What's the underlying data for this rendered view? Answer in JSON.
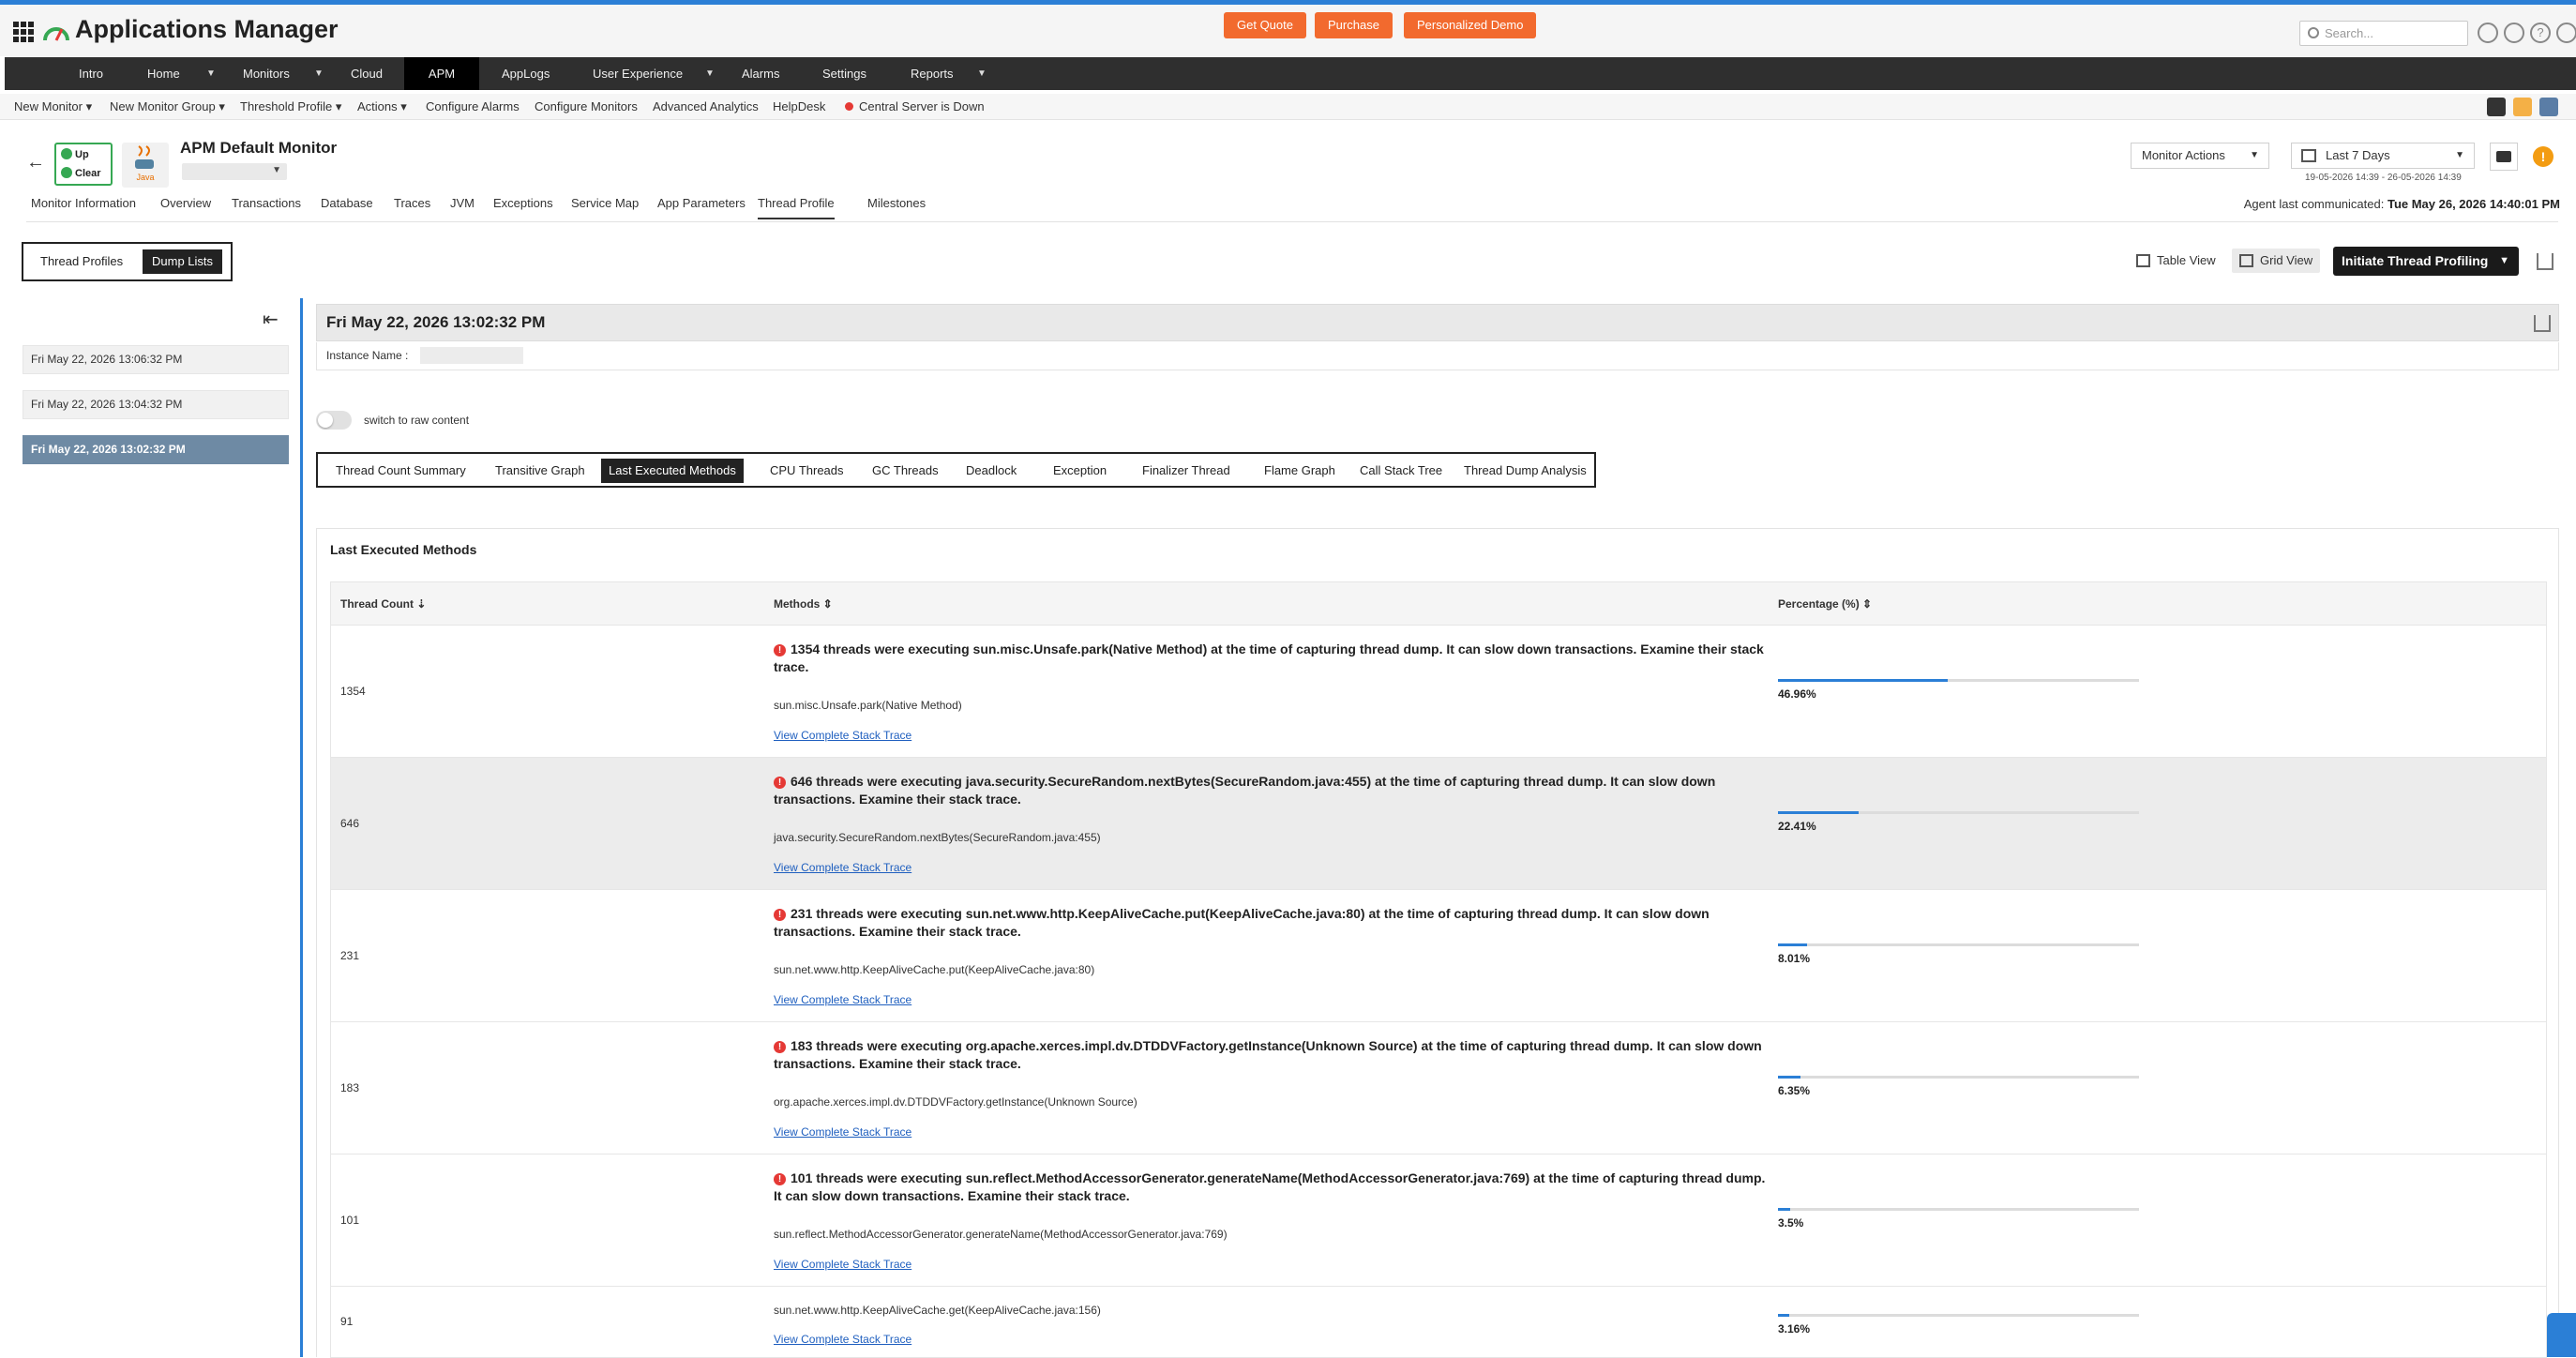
{
  "header": {
    "app_title": "Applications Manager",
    "buttons": {
      "get_quote": "Get Quote",
      "purchase": "Purchase",
      "demo": "Personalized Demo"
    },
    "search_placeholder": "Search..."
  },
  "nav": [
    "Intro",
    "Home",
    "Monitors",
    "Cloud",
    "APM",
    "AppLogs",
    "User Experience",
    "Alarms",
    "Settings",
    "Reports"
  ],
  "toolbar": {
    "items": [
      "New Monitor",
      "New Monitor Group",
      "Threshold Profile",
      "Actions",
      "Configure Alarms",
      "Configure Monitors",
      "Advanced Analytics",
      "HelpDesk"
    ],
    "server_status": "Central Server is Down"
  },
  "monitor": {
    "title": "APM Default Monitor",
    "status_up": "Up",
    "status_clear": "Clear",
    "java_label": "Java",
    "actions": "Monitor Actions",
    "period": "Last 7 Days",
    "date_range": "19-05-2026 14:39 - 26-05-2026 14:39",
    "agent_label": "Agent last communicated:",
    "agent_time": "Tue May 26, 2026 14:40:01 PM"
  },
  "monitor_tabs": [
    "Monitor Information",
    "Overview",
    "Transactions",
    "Database",
    "Traces",
    "JVM",
    "Exceptions",
    "Service Map",
    "App Parameters",
    "Thread Profile",
    "Milestones"
  ],
  "seg": {
    "thread_profiles": "Thread Profiles",
    "dump_lists": "Dump Lists"
  },
  "views": {
    "table": "Table View",
    "grid": "Grid View",
    "initiate": "Initiate Thread Profiling"
  },
  "dumps": [
    "Fri May 22, 2026 13:06:32 PM",
    "Fri May 22, 2026 13:04:32 PM",
    "Fri May 22, 2026 13:02:32 PM"
  ],
  "content": {
    "dump_title": "Fri May 22, 2026 13:02:32 PM",
    "instance_label": "Instance Name :",
    "raw_toggle": "switch to raw content"
  },
  "sub_tabs": [
    "Thread Count Summary",
    "Transitive Graph",
    "Last Executed Methods",
    "CPU Threads",
    "GC Threads",
    "Deadlock",
    "Exception",
    "Finalizer Thread",
    "Flame Graph",
    "Call Stack Tree",
    "Thread Dump Analysis"
  ],
  "lem": {
    "title": "Last Executed Methods",
    "columns": [
      "Thread Count",
      "Methods",
      "Percentage (%)"
    ],
    "view_link": "View Complete Stack Trace",
    "rows": [
      {
        "count": "1354",
        "message": "1354 threads were executing sun.misc.Unsafe.park(Native Method) at the time of capturing thread dump. It can slow down transactions. Examine their stack trace.",
        "method": "sun.misc.Unsafe.park(Native Method)",
        "pct": 46.96,
        "pct_label": "46.96%"
      },
      {
        "count": "646",
        "message": "646 threads were executing java.security.SecureRandom.nextBytes(SecureRandom.java:455) at the time of capturing thread dump. It can slow down transactions. Examine their stack trace.",
        "method": "java.security.SecureRandom.nextBytes(SecureRandom.java:455)",
        "pct": 22.41,
        "pct_label": "22.41%"
      },
      {
        "count": "231",
        "message": "231 threads were executing sun.net.www.http.KeepAliveCache.put(KeepAliveCache.java:80) at the time of capturing thread dump. It can slow down transactions. Examine their stack trace.",
        "method": "sun.net.www.http.KeepAliveCache.put(KeepAliveCache.java:80)",
        "pct": 8.01,
        "pct_label": "8.01%"
      },
      {
        "count": "183",
        "message": "183 threads were executing org.apache.xerces.impl.dv.DTDDVFactory.getInstance(Unknown Source) at the time of capturing thread dump. It can slow down transactions. Examine their stack trace.",
        "method": "org.apache.xerces.impl.dv.DTDDVFactory.getInstance(Unknown Source)",
        "pct": 6.35,
        "pct_label": "6.35%"
      },
      {
        "count": "101",
        "message": "101 threads were executing sun.reflect.MethodAccessorGenerator.generateName(MethodAccessorGenerator.java:769) at the time of capturing thread dump. It can slow down transactions. Examine their stack trace.",
        "method": "sun.reflect.MethodAccessorGenerator.generateName(MethodAccessorGenerator.java:769)",
        "pct": 3.5,
        "pct_label": "3.5%"
      },
      {
        "count": "91",
        "message": "",
        "method": "sun.net.www.http.KeepAliveCache.get(KeepAliveCache.java:156)",
        "pct": 3.16,
        "pct_label": "3.16%"
      }
    ]
  },
  "colors": {
    "accent": "#2b7fd6",
    "orange": "#f26a2e",
    "nav": "#2f2f2f",
    "error": "#e53935",
    "success": "#36a853"
  }
}
